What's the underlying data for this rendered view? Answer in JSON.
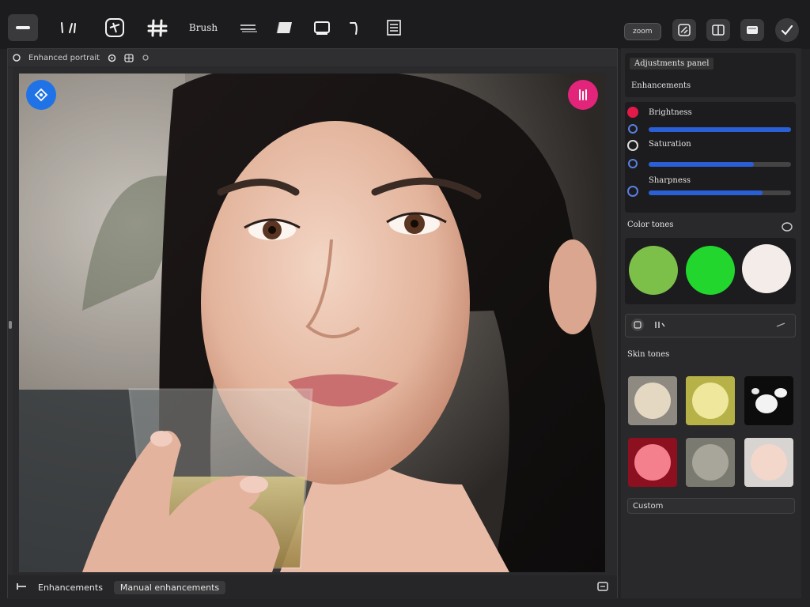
{
  "toolbar": {
    "text_tool_label": "Brush",
    "zoom_label": "zoom"
  },
  "canvas": {
    "title": "Enhanced portrait",
    "footer_primary": "Enhancements",
    "footer_secondary": "Manual enhancements"
  },
  "side": {
    "header_title": "Adjustments panel",
    "header_sub": "Enhancements",
    "slider_1_label": "Brightness",
    "slider_2_label": "Saturation",
    "slider_3_label": "Sharpness",
    "slider_1_value": 1.0,
    "slider_2_value": 0.74,
    "slider_3_value": 0.8,
    "colors_title": "Color tones",
    "tones_title": "Skin tones",
    "dropdown_value": "",
    "bottom_label": "Custom"
  },
  "colors": {
    "accent_blue": "#2a5fd6",
    "accent_pink": "#e2247a",
    "swatch_1": "#7cc04a",
    "swatch_2": "#22d62e",
    "swatch_3": "#f3ece9",
    "tile_1": "#e4d8c2",
    "tile_2": "#eee79c",
    "tile_4": "#f4808d",
    "tile_5": "#a8a69a",
    "tile_6": "#f3d7cb"
  }
}
